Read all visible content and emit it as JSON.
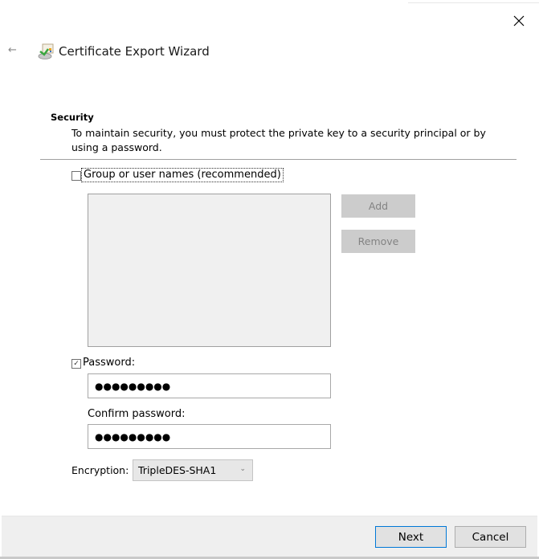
{
  "window": {
    "title": "Certificate Export Wizard",
    "close_icon": "close-icon",
    "back_icon": "back-arrow-icon",
    "back_glyph": "←",
    "wizard_icon": "certificate-export-icon"
  },
  "section": {
    "title": "Security",
    "description": "To maintain security, you must protect the private key to a security principal or by using a password."
  },
  "group_option": {
    "label": "Group or user names (recommended)",
    "checked": false
  },
  "buttons_side": {
    "add": "Add",
    "remove": "Remove"
  },
  "password_option": {
    "label": "Password:",
    "checked": true,
    "check_glyph": "✓",
    "value": "●●●●●●●●●"
  },
  "confirm_password": {
    "label": "Confirm password:",
    "value": "●●●●●●●●●"
  },
  "encryption": {
    "label": "Encryption:",
    "selected": "TripleDES-SHA1",
    "chevron": "⌄"
  },
  "footer": {
    "next": "Next",
    "cancel": "Cancel"
  },
  "colors": {
    "accent": "#0078d7",
    "disabled_button": "#cccccc",
    "footer_bg": "#efefef"
  }
}
